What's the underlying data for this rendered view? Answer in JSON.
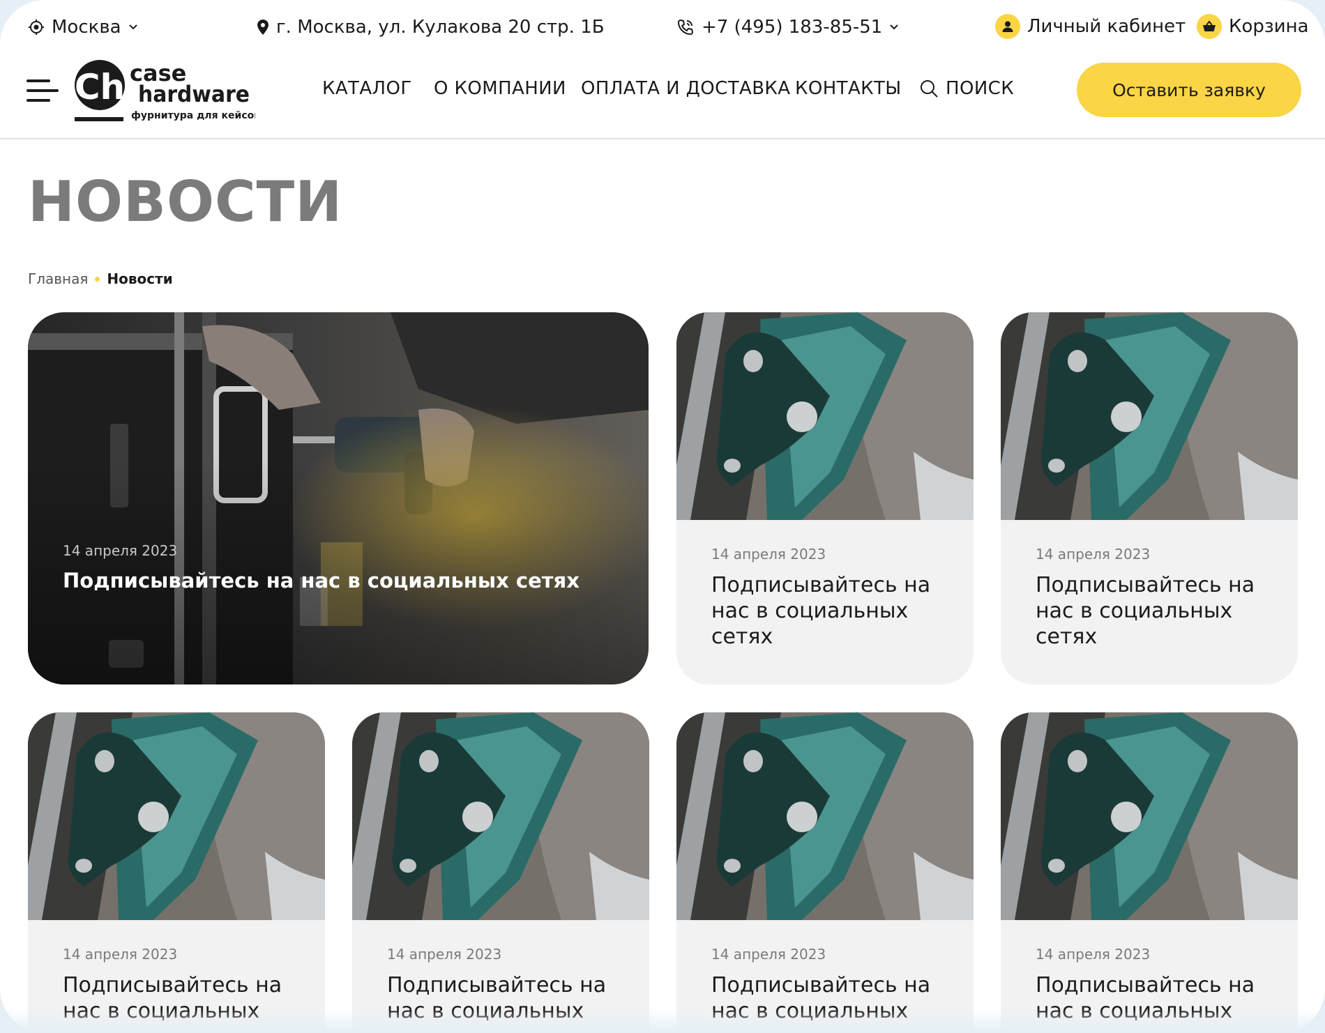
{
  "topbar": {
    "city": "Москва",
    "address": "г. Москва, ул. Кулакова 20 стр. 1Б",
    "phone": "+7 (495) 183-85-51",
    "cabinet": "Личный кабинет",
    "cart": "Корзина"
  },
  "logo": {
    "line1": "case",
    "line2": "hardware",
    "tagline": "фурнитура для кейсов",
    "mark": "Ch"
  },
  "nav": {
    "items": [
      "КАТАЛОГ",
      "О КОМПАНИИ",
      "ОПЛАТА И ДОСТАВКА",
      "КОНТАКТЫ"
    ],
    "search": "ПОИСК",
    "cta": "Оставить заявку"
  },
  "page": {
    "title": "НОВОСТИ",
    "breadcrumb": [
      "Главная",
      "Новости"
    ]
  },
  "news": [
    {
      "date": "14 апреля 2023",
      "title": "Подписывайтесь на нас в социальных сетях",
      "featured": true
    },
    {
      "date": "14 апреля 2023",
      "title": "Подписывайтесь на нас в социальных сетях"
    },
    {
      "date": "14 апреля 2023",
      "title": "Подписывайтесь на нас в социальных сетях"
    },
    {
      "date": "14 апреля 2023",
      "title": "Подписывайтесь на нас в социальных"
    },
    {
      "date": "14 апреля 2023",
      "title": "Подписывайтесь на нас в социальных"
    },
    {
      "date": "14 апреля 2023",
      "title": "Подписывайтесь на нас в социальных"
    },
    {
      "date": "14 апреля 2023",
      "title": "Подписывайтесь на нас в социальных"
    }
  ],
  "colors": {
    "accent": "#fad545",
    "title_gray": "#7b7b7b",
    "card_bg": "#f2f2f2",
    "frame_edge": "#e6eef6"
  },
  "icons": [
    "location-target-icon",
    "chevron-down-icon",
    "map-pin-icon",
    "phone-icon",
    "user-icon",
    "basket-icon",
    "burger-menu-icon",
    "search-icon"
  ]
}
